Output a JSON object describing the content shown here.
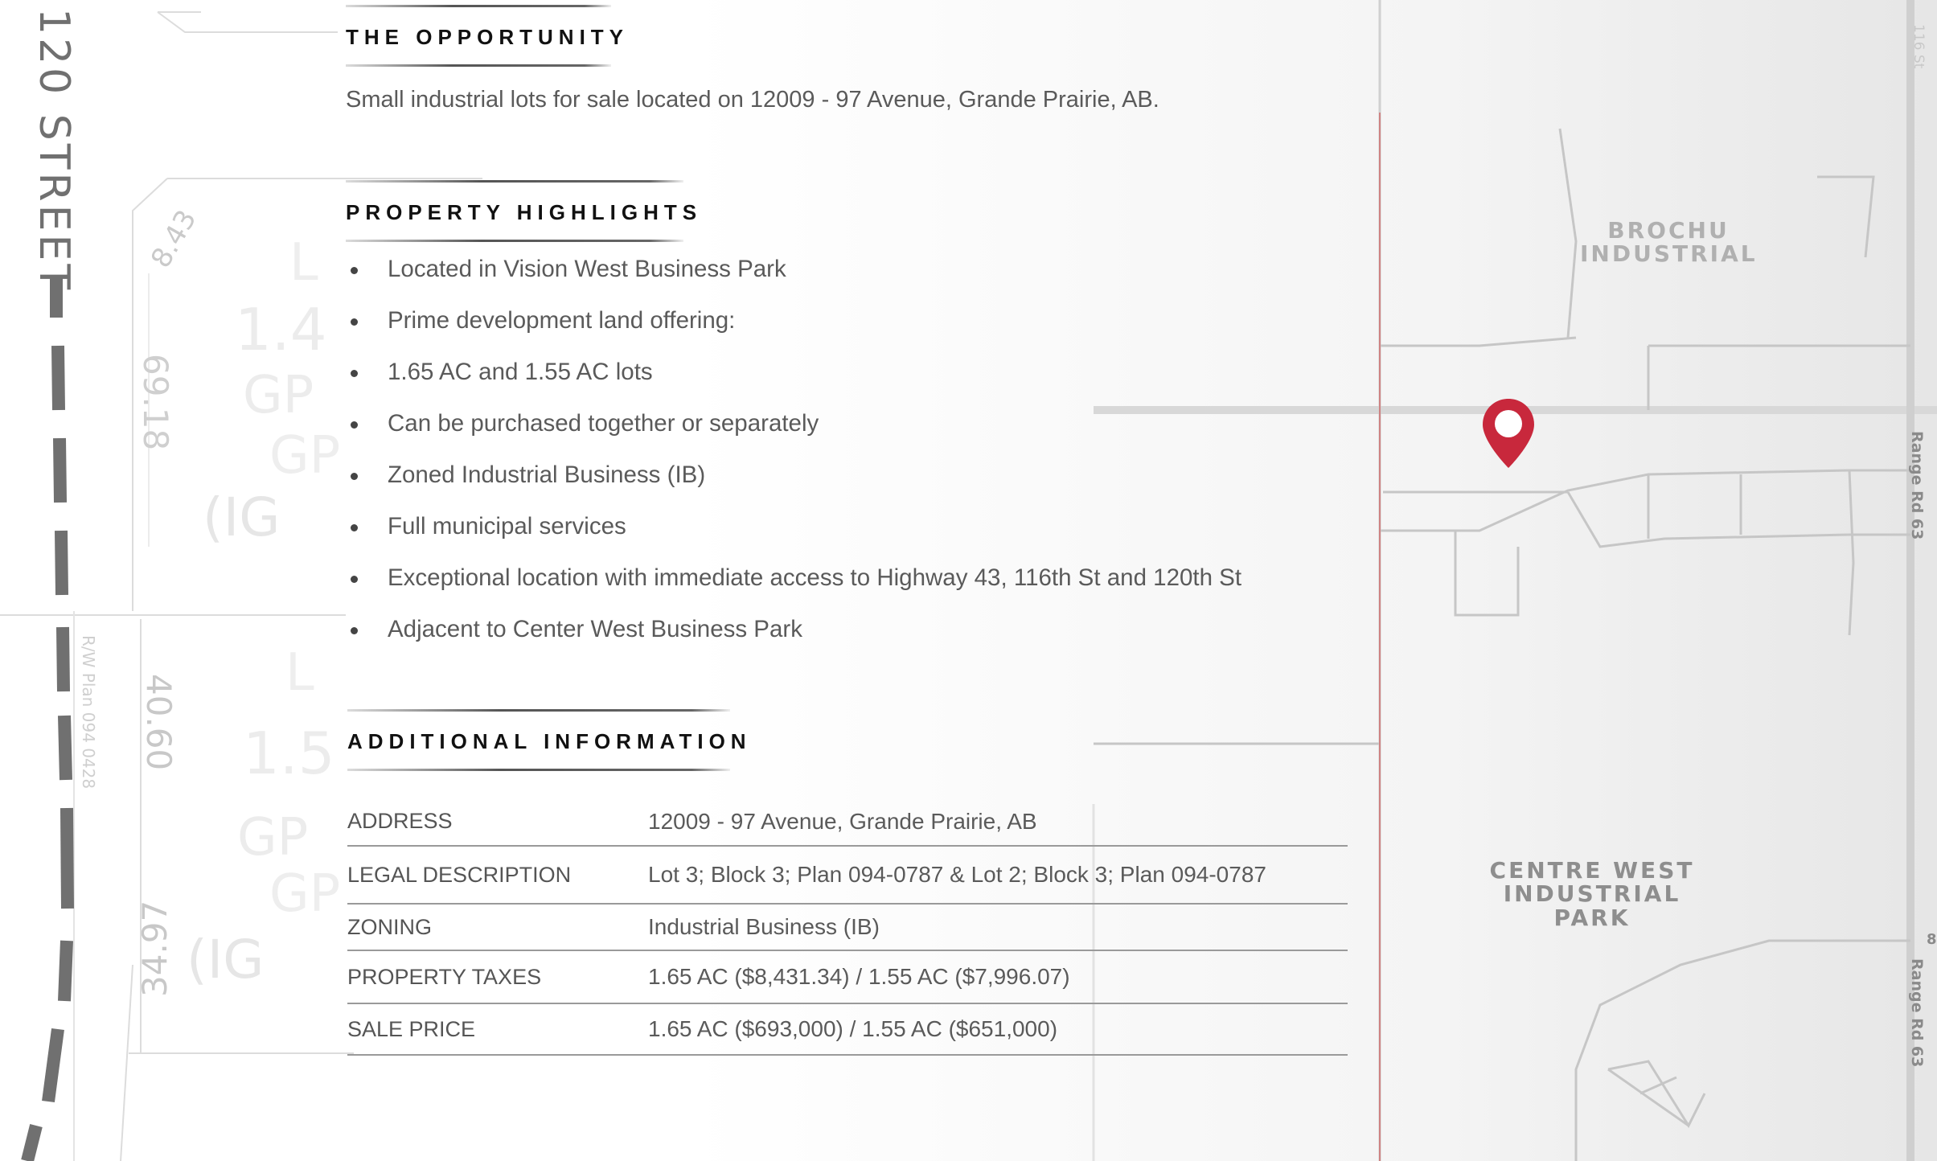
{
  "opportunity": {
    "title": "THE OPPORTUNITY",
    "text": "Small industrial lots for sale located on 12009 - 97 Avenue, Grande Prairie, AB."
  },
  "highlights": {
    "title": "PROPERTY HIGHLIGHTS",
    "items": [
      "Located in Vision West Business Park",
      "Prime development land offering:",
      "1.65 AC and 1.55 AC lots",
      "Can be purchased together or separately",
      "Zoned Industrial Business (IB)",
      "Full municipal services",
      "Exceptional location with immediate access to Highway 43, 116th St and 120th St",
      "Adjacent to Center West Business Park"
    ]
  },
  "additional": {
    "title": "ADDITIONAL INFORMATION",
    "rows": [
      {
        "label": "ADDRESS",
        "value": "12009 - 97 Avenue, Grande Prairie, AB"
      },
      {
        "label": "LEGAL DESCRIPTION",
        "value": "Lot 3; Block 3; Plan 094-0787 & Lot 2; Block 3; Plan 094-0787"
      },
      {
        "label": "ZONING",
        "value": "Industrial Business (IB)"
      },
      {
        "label": "PROPERTY TAXES",
        "value": "1.65 AC ($8,431.34) / 1.55 AC ($7,996.07)"
      },
      {
        "label": "SALE PRICE",
        "value": "1.65 AC ($693,000) / 1.55 AC ($651,000)"
      }
    ]
  },
  "map": {
    "label_brochu_1": "BROCHU",
    "label_brochu_2": "INDUSTRIAL",
    "label_centre_1": "CENTRE WEST",
    "label_centre_2": "INDUSTRIAL PARK",
    "road_range_1": "Range Rd 63",
    "road_range_2": "Range Rd 63",
    "road_116": "116 St",
    "road_8": "8",
    "pin_color": "#c8283c"
  },
  "plan": {
    "street": "120 STREET",
    "dim_1": "69.18",
    "dim_2": "40.60",
    "dim_3": "34.97",
    "dim_4": "8.43",
    "rw_plan": "R/W Plan 094 0428",
    "lot_1_area": "1.4",
    "lot_1_zone": "GP",
    "lot_1_zone2": "GP",
    "lot_1_ig": "(IG",
    "lot_2_area": "1.5",
    "lot_2_zone": "GP",
    "lot_2_zone2": "GP",
    "lot_2_ig": "(IG",
    "lot_1_letter": "L",
    "lot_2_letter": "L"
  }
}
